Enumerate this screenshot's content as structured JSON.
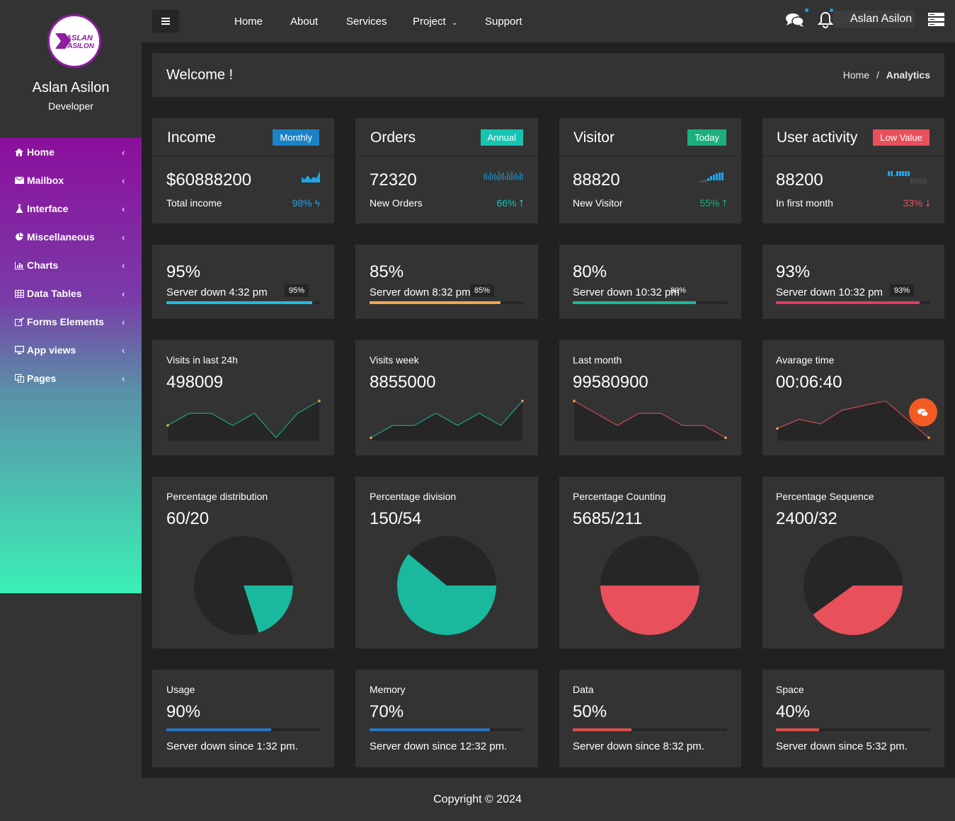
{
  "profile": {
    "name": "Aslan Asilon",
    "role": "Developer",
    "logo_line1": "ASLAN",
    "logo_line2": "ASILON"
  },
  "sidebar": {
    "items": [
      {
        "label": "Home",
        "icon": "home-icon"
      },
      {
        "label": "Mailbox",
        "icon": "envelope-icon"
      },
      {
        "label": "Interface",
        "icon": "flask-icon"
      },
      {
        "label": "Miscellaneous",
        "icon": "pie-chart-icon"
      },
      {
        "label": "Charts",
        "icon": "bar-chart-icon"
      },
      {
        "label": "Data Tables",
        "icon": "table-icon"
      },
      {
        "label": "Forms Elements",
        "icon": "edit-icon"
      },
      {
        "label": "App views",
        "icon": "desktop-icon"
      },
      {
        "label": "Pages",
        "icon": "copy-icon"
      }
    ]
  },
  "topnav": {
    "items": [
      "Home",
      "About",
      "Services",
      "Project",
      "Support"
    ],
    "user": "Aslan Asilon"
  },
  "header": {
    "title": "Welcome !",
    "breadcrumb": [
      "Home",
      "/",
      "Analytics"
    ]
  },
  "stats": [
    {
      "title": "Income",
      "badge": "Monthly",
      "badge_color": "#1a82c7",
      "value": "$60888200",
      "label": "Total income",
      "pct": "98%",
      "pct_color": "#1ea4e9"
    },
    {
      "title": "Orders",
      "badge": "Annual",
      "badge_color": "#17c3b2",
      "value": "72320",
      "label": "New Orders",
      "pct": "66%",
      "pct_color": "#17c3b2"
    },
    {
      "title": "Visitor",
      "badge": "Today",
      "badge_color": "#1aaf7d",
      "value": "88820",
      "label": "New Visitor",
      "pct": "55%",
      "pct_color": "#1aaf7d"
    },
    {
      "title": "User activity",
      "badge": "Low Value",
      "badge_color": "#e8505b",
      "value": "88200",
      "label": "In first month",
      "pct": "33%",
      "pct_color": "#e8505b"
    }
  ],
  "progress": [
    {
      "value": "95%",
      "label": "Server down 4:32 pm",
      "tip": "95%",
      "fill": 0.95,
      "color": "#1ebde4"
    },
    {
      "value": "85%",
      "label": "Server down 8:32 pm",
      "tip": "85%",
      "fill": 0.85,
      "color": "#f2a64b"
    },
    {
      "value": "80%",
      "label": "Server down 10:32 pm",
      "tip": "80%",
      "fill": 0.8,
      "color": "#1ab99e"
    },
    {
      "value": "93%",
      "label": "Server down 10:32 pm",
      "tip": "93%",
      "fill": 0.93,
      "color": "#e5395f"
    }
  ],
  "visits": [
    {
      "label": "Visits in last 24h",
      "value": "498009"
    },
    {
      "label": "Visits week",
      "value": "8855000"
    },
    {
      "label": "Last month",
      "value": "99580900"
    },
    {
      "label": "Avarage time",
      "value": "00:06:40"
    }
  ],
  "percentages": [
    {
      "label": "Percentage distribution",
      "value": "60/20"
    },
    {
      "label": "Percentage division",
      "value": "150/54"
    },
    {
      "label": "Percentage Counting",
      "value": "5685/211"
    },
    {
      "label": "Percentage Sequence",
      "value": "2400/32"
    }
  ],
  "usage": [
    {
      "label": "Usage",
      "value": "90%",
      "note": "Server down since 1:32 pm.",
      "fill": 0.68,
      "color": "#2a74c1"
    },
    {
      "label": "Memory",
      "value": "70%",
      "note": "Server down since 12:32 pm.",
      "fill": 0.78,
      "color": "#2a74c1"
    },
    {
      "label": "Data",
      "value": "50%",
      "note": "Server down since 8:32 pm.",
      "fill": 0.38,
      "color": "#d84f4f"
    },
    {
      "label": "Space",
      "value": "40%",
      "note": "Server down since 5:32 pm.",
      "fill": 0.28,
      "color": "#d84f4f"
    }
  ],
  "chart_data": [
    {
      "type": "area",
      "series": [
        {
          "values": [
            5,
            6,
            6,
            5,
            6,
            4,
            6,
            7
          ]
        }
      ],
      "color": "#1ab99e"
    },
    {
      "type": "area",
      "series": [
        {
          "values": [
            4,
            5,
            5,
            6,
            5,
            6,
            5,
            7
          ]
        }
      ],
      "color": "#1ab99e"
    },
    {
      "type": "area",
      "series": [
        {
          "values": [
            7,
            6,
            5,
            6,
            6,
            5,
            5,
            4
          ]
        }
      ],
      "color": "#e8505b"
    },
    {
      "type": "area",
      "series": [
        {
          "values": [
            3,
            4,
            3.5,
            5,
            5.5,
            6,
            4,
            2
          ]
        }
      ],
      "color": "#e8505b"
    },
    {
      "type": "pie",
      "values": [
        20,
        80
      ],
      "color": "#1ab99e"
    },
    {
      "type": "pie",
      "values": [
        61,
        39
      ],
      "color": "#1ab99e"
    },
    {
      "type": "pie",
      "values": [
        50,
        50
      ],
      "color": "#e8505b"
    },
    {
      "type": "pie",
      "values": [
        40,
        60
      ],
      "color": "#e8505b"
    }
  ],
  "footer": {
    "text": "Copyright © 2024"
  }
}
